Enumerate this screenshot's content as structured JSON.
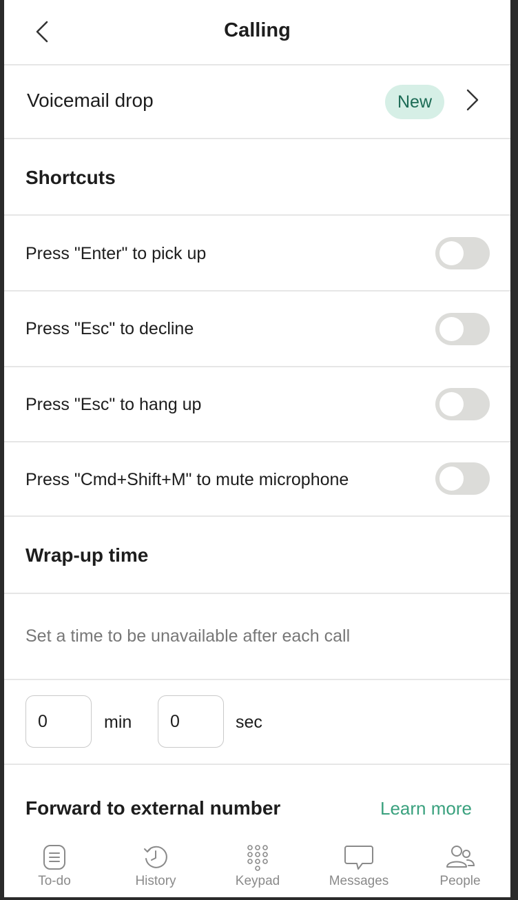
{
  "header": {
    "title": "Calling",
    "back_icon": "chevron-left-icon"
  },
  "voicemail": {
    "label": "Voicemail drop",
    "badge": "New",
    "badge_color": "#d6efe6",
    "badge_text_color": "#1c6b55"
  },
  "shortcuts": {
    "heading": "Shortcuts",
    "items": [
      {
        "label": "Press \"Enter\" to pick up",
        "enabled": false
      },
      {
        "label": "Press \"Esc\" to decline",
        "enabled": false
      },
      {
        "label": "Press \"Esc\" to hang up",
        "enabled": false
      },
      {
        "label": "Press \"Cmd+Shift+M\" to mute microphone",
        "enabled": false
      }
    ]
  },
  "wrapup": {
    "heading": "Wrap-up time",
    "hint": "Set a time to be unavailable after each call",
    "minutes": "0",
    "minutes_unit": "min",
    "seconds": "0",
    "seconds_unit": "sec"
  },
  "forward": {
    "heading": "Forward to external number",
    "learn_more": "Learn more",
    "link_color": "#3aa17e"
  },
  "tabbar": {
    "tabs": [
      {
        "label": "To-do",
        "icon": "todo-list-icon"
      },
      {
        "label": "History",
        "icon": "clock-history-icon"
      },
      {
        "label": "Keypad",
        "icon": "keypad-icon"
      },
      {
        "label": "Messages",
        "icon": "chat-bubble-icon"
      },
      {
        "label": "People",
        "icon": "people-icon"
      }
    ]
  }
}
